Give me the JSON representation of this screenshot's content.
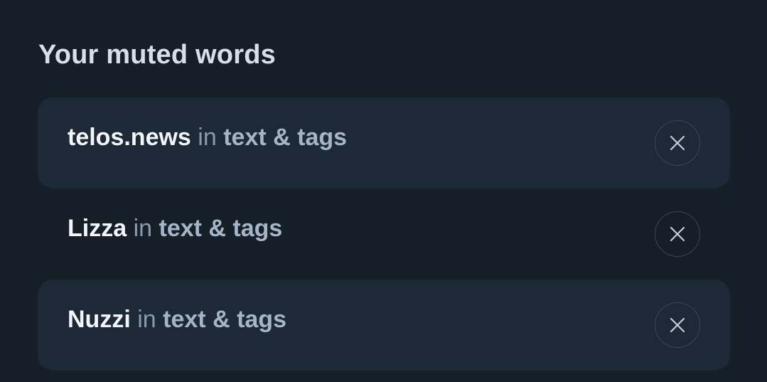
{
  "heading": "Your muted words",
  "muted_words": [
    {
      "word": "telos.news",
      "connector": "in",
      "scope": "text & tags",
      "remove_label": "Remove"
    },
    {
      "word": "Lizza",
      "connector": "in",
      "scope": "text & tags",
      "remove_label": "Remove"
    },
    {
      "word": "Nuzzi",
      "connector": "in",
      "scope": "text & tags",
      "remove_label": "Remove"
    }
  ],
  "colors": {
    "background": "#161e27",
    "row_shaded": "#1e2937",
    "heading": "#d6dfea",
    "word": "#f2f5f9",
    "scope": "#a5b5c8",
    "connector": "#8a9bb0"
  },
  "icons": {
    "remove": "close-icon"
  }
}
